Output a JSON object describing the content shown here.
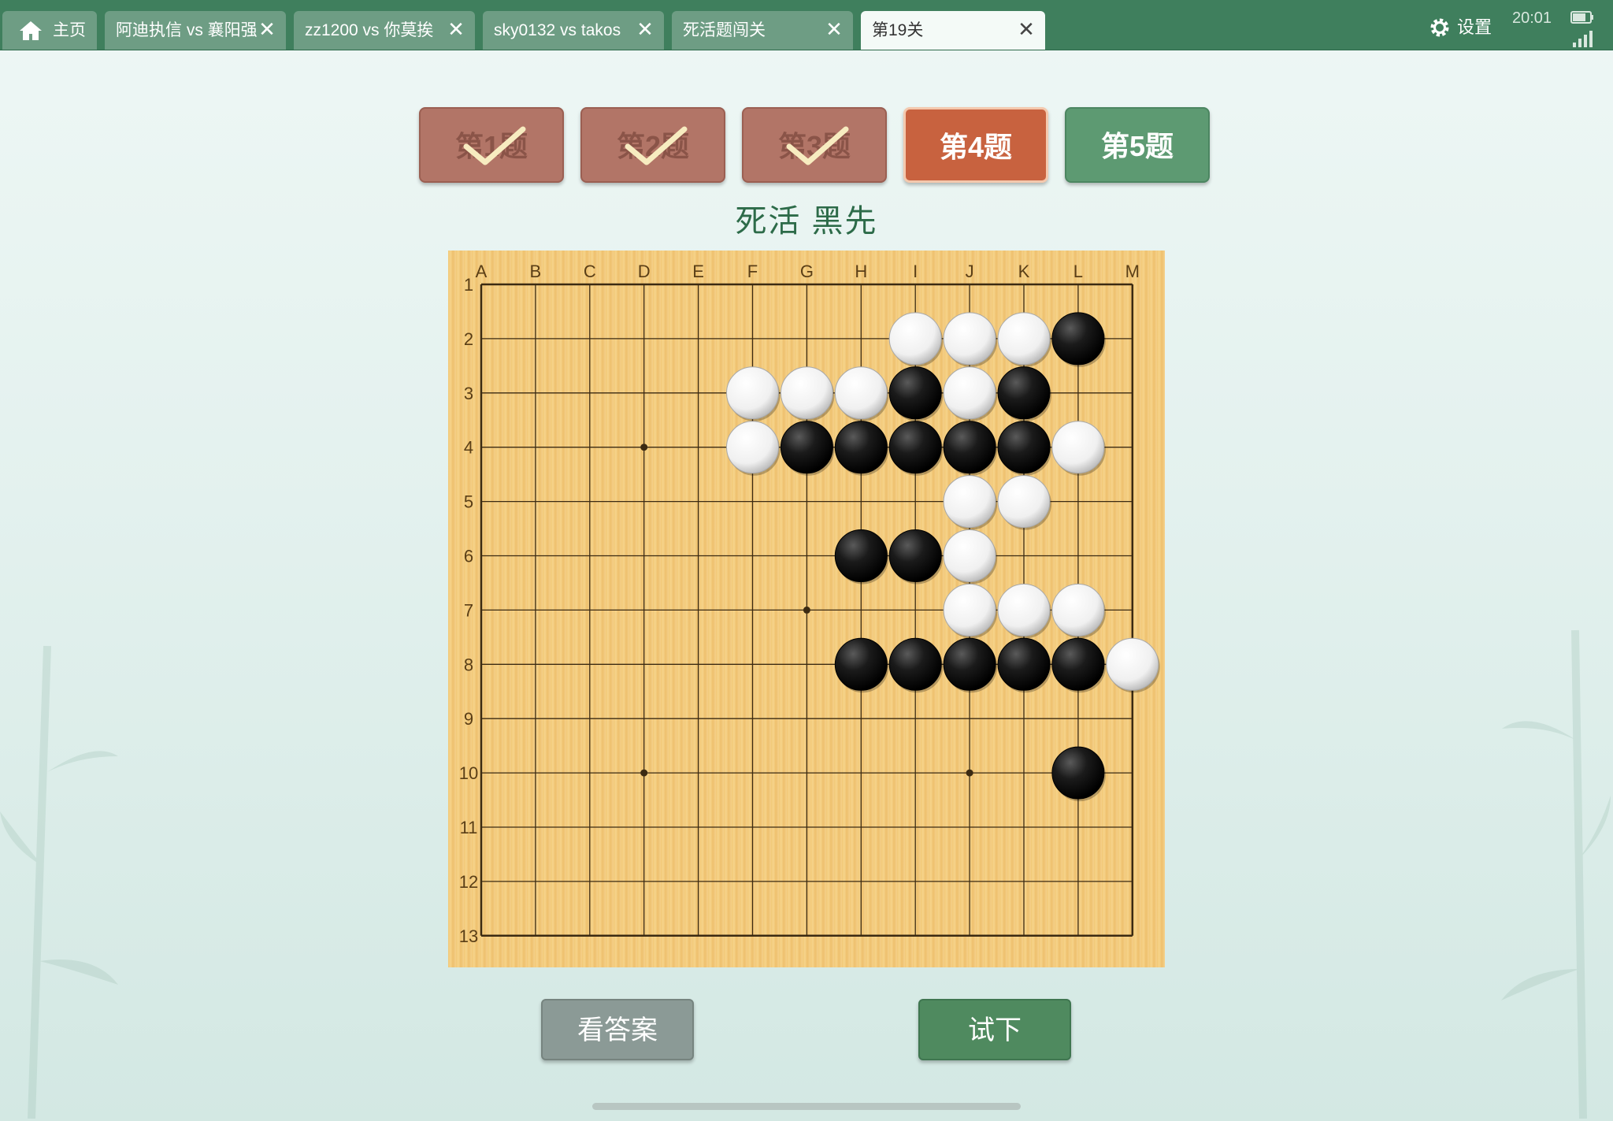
{
  "tabs": [
    {
      "label": "主页",
      "home": true
    },
    {
      "label": "阿迪执信 vs 襄阳强",
      "close": "✕"
    },
    {
      "label": "zz1200 vs 你莫挨",
      "close": "✕"
    },
    {
      "label": "sky0132 vs takos",
      "close": "✕"
    },
    {
      "label": "死活题闯关",
      "close": "✕"
    },
    {
      "label": "第19关",
      "close": "✕",
      "active": true
    }
  ],
  "status": {
    "settings_label": "设置",
    "time": "20:01"
  },
  "problems": [
    {
      "label": "第1题",
      "state": "done"
    },
    {
      "label": "第2题",
      "state": "done"
    },
    {
      "label": "第3题",
      "state": "done"
    },
    {
      "label": "第4题",
      "state": "current"
    },
    {
      "label": "第5题",
      "state": "next"
    }
  ],
  "problem_title": "死活 黑先",
  "board": {
    "size": 13,
    "columns": [
      "A",
      "B",
      "C",
      "D",
      "E",
      "F",
      "G",
      "H",
      "I",
      "J",
      "K",
      "L",
      "M"
    ],
    "rows": [
      "1",
      "2",
      "3",
      "4",
      "5",
      "6",
      "7",
      "8",
      "9",
      "10",
      "11",
      "12",
      "13"
    ],
    "star_points": [
      "D4",
      "G7",
      "D10",
      "J10"
    ],
    "stones": [
      {
        "pos": "I2",
        "color": "white"
      },
      {
        "pos": "J2",
        "color": "white"
      },
      {
        "pos": "K2",
        "color": "white"
      },
      {
        "pos": "L2",
        "color": "black"
      },
      {
        "pos": "F3",
        "color": "white"
      },
      {
        "pos": "G3",
        "color": "white"
      },
      {
        "pos": "H3",
        "color": "white"
      },
      {
        "pos": "I3",
        "color": "black"
      },
      {
        "pos": "J3",
        "color": "white"
      },
      {
        "pos": "K3",
        "color": "black"
      },
      {
        "pos": "F4",
        "color": "white"
      },
      {
        "pos": "G4",
        "color": "black"
      },
      {
        "pos": "H4",
        "color": "black"
      },
      {
        "pos": "I4",
        "color": "black"
      },
      {
        "pos": "J4",
        "color": "black"
      },
      {
        "pos": "K4",
        "color": "black"
      },
      {
        "pos": "L4",
        "color": "white"
      },
      {
        "pos": "J5",
        "color": "white"
      },
      {
        "pos": "K5",
        "color": "white"
      },
      {
        "pos": "H6",
        "color": "black"
      },
      {
        "pos": "I6",
        "color": "black"
      },
      {
        "pos": "J6",
        "color": "white"
      },
      {
        "pos": "J7",
        "color": "white"
      },
      {
        "pos": "K7",
        "color": "white"
      },
      {
        "pos": "L7",
        "color": "white"
      },
      {
        "pos": "H8",
        "color": "black"
      },
      {
        "pos": "I8",
        "color": "black"
      },
      {
        "pos": "J8",
        "color": "black"
      },
      {
        "pos": "K8",
        "color": "black"
      },
      {
        "pos": "L8",
        "color": "black"
      },
      {
        "pos": "M8",
        "color": "white"
      },
      {
        "pos": "L10",
        "color": "black"
      }
    ]
  },
  "actions": {
    "answer_label": "看答案",
    "try_label": "试下"
  },
  "colors": {
    "tabbar": "#3f7f5d",
    "done": "#b27567",
    "current": "#c8623f",
    "next": "#5d9a72",
    "board": "#f2c97a"
  }
}
